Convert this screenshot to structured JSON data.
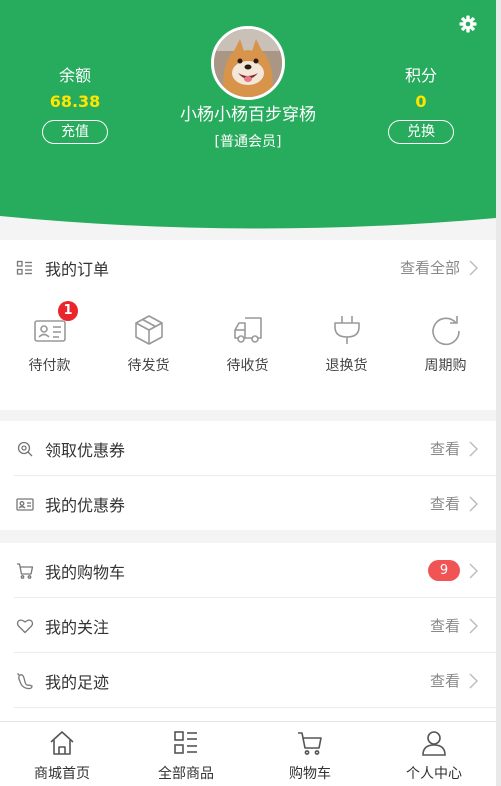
{
  "profile": {
    "balance_label": "余额",
    "balance_value": "68.38",
    "recharge_button": "充值",
    "points_label": "积分",
    "points_value": "0",
    "exchange_button": "兑换",
    "username": "小杨小杨百步穿杨",
    "level": "[普通会员]"
  },
  "orders": {
    "title": "我的订单",
    "view_all": "查看全部",
    "items": [
      {
        "label": "待付款",
        "icon": "pending-payment-icon",
        "badge": "1"
      },
      {
        "label": "待发货",
        "icon": "box-icon"
      },
      {
        "label": "待收货",
        "icon": "truck-icon"
      },
      {
        "label": "退换货",
        "icon": "plug-icon"
      },
      {
        "label": "周期购",
        "icon": "refresh-icon"
      }
    ]
  },
  "coupons": {
    "get_label": "领取优惠券",
    "get_action": "查看",
    "mine_label": "我的优惠券",
    "mine_action": "查看"
  },
  "personal": {
    "cart_label": "我的购物车",
    "cart_count": "9",
    "follow_label": "我的关注",
    "follow_action": "查看",
    "footprint_label": "我的足迹",
    "footprint_action": "查看"
  },
  "tabbar": {
    "tabs": [
      {
        "label": "商城首页",
        "icon": "home-icon"
      },
      {
        "label": "全部商品",
        "icon": "category-icon"
      },
      {
        "label": "购物车",
        "icon": "cart-icon"
      },
      {
        "label": "个人中心",
        "icon": "person-icon"
      }
    ]
  },
  "colors": {
    "brand_green": "#27ab5c",
    "value_yellow": "#ffe600",
    "badge_red": "#e8262c"
  }
}
